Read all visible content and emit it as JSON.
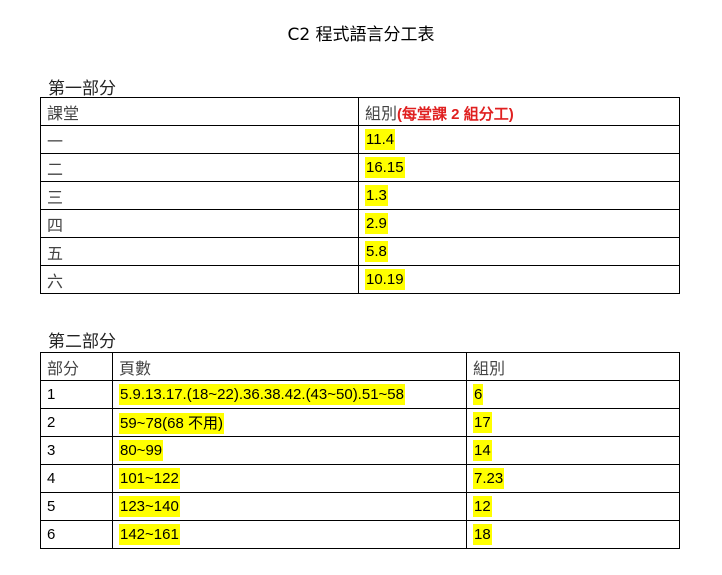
{
  "title": "C2 程式語言分工表",
  "section1": {
    "title": "第一部分",
    "headers": {
      "class": "課堂",
      "group_prefix": "組別",
      "group_note": "(每堂課 2 組分工)"
    },
    "rows": [
      {
        "class": "一",
        "group": "11.4"
      },
      {
        "class": "二",
        "group": "16.15"
      },
      {
        "class": "三",
        "group": "1.3"
      },
      {
        "class": "四",
        "group": "2.9"
      },
      {
        "class": "五",
        "group": "5.8"
      },
      {
        "class": "六",
        "group": "10.19"
      }
    ]
  },
  "section2": {
    "title": "第二部分",
    "headers": {
      "part": "部分",
      "pages": "頁數",
      "group": "組別"
    },
    "rows": [
      {
        "part": "1",
        "pages": "5.9.13.17.(18~22).36.38.42.(43~50).51~58",
        "group": "6"
      },
      {
        "part": "2",
        "pages": "59~78(68 不用)",
        "group": "17"
      },
      {
        "part": "3",
        "pages": "80~99",
        "group": "14"
      },
      {
        "part": "4",
        "pages": "101~122",
        "group": "7.23"
      },
      {
        "part": "5",
        "pages": "123~140",
        "group": "12"
      },
      {
        "part": "6",
        "pages": "142~161",
        "group": "18"
      }
    ]
  },
  "colors": {
    "highlight": "#ffff00",
    "note_red": "#e02020"
  }
}
